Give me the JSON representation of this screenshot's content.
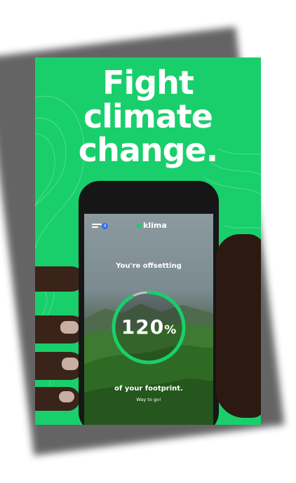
{
  "poster": {
    "headline": [
      "Fight",
      "climate",
      "change."
    ],
    "bg_color": "#19cf6b"
  },
  "app": {
    "menu_icon": "hamburger-menu-icon",
    "notification_count": "4",
    "brand": "klima",
    "subtitle": "You're offsetting",
    "percent_value": "120",
    "percent_symbol": "%",
    "progress": 1.2,
    "footprint_text": "of your footprint.",
    "cheer_text": "Way to go!",
    "accent_color": "#19cf6b"
  }
}
